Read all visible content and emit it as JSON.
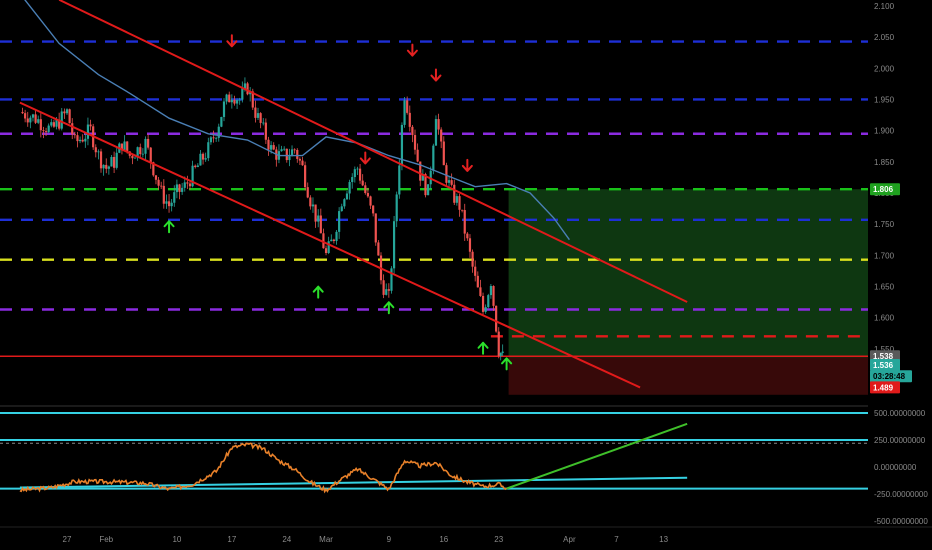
{
  "chart_data": {
    "type": "candlestick",
    "colors": {
      "background": "#000000",
      "up_candle": "#26a69a",
      "down_candle": "#ef5350",
      "channel": "#e11a1a",
      "moving_average": "#4a7fb5",
      "rsi_line": "#e8812a",
      "cyan_line": "#35d1e3",
      "green_trendline": "#3fbf2a",
      "target_zone": "#0f3a12",
      "stop_zone": "#3a0a0a"
    },
    "price_axis": {
      "ticks": [
        "2.100",
        "2.050",
        "2.000",
        "1.950",
        "1.900",
        "1.850",
        "1.800",
        "1.750",
        "1.700",
        "1.650",
        "1.600",
        "1.550",
        "1.500"
      ],
      "range": [
        1.48,
        2.11
      ]
    },
    "x_axis": {
      "ticks": [
        {
          "label": "27",
          "day": 0
        },
        {
          "label": "Feb",
          "day": 5
        },
        {
          "label": "10",
          "day": 14
        },
        {
          "label": "17",
          "day": 21
        },
        {
          "label": "24",
          "day": 28
        },
        {
          "label": "Mar",
          "day": 33
        },
        {
          "label": "9",
          "day": 41
        },
        {
          "label": "16",
          "day": 48
        },
        {
          "label": "23",
          "day": 55
        },
        {
          "label": "Apr",
          "day": 64
        },
        {
          "label": "7",
          "day": 70
        },
        {
          "label": "13",
          "day": 76
        }
      ]
    },
    "price_series": [
      {
        "day": -6,
        "p": 1.93
      },
      {
        "day": -4,
        "p": 1.92
      },
      {
        "day": -2,
        "p": 1.9
      },
      {
        "day": 0,
        "p": 1.93
      },
      {
        "day": 1,
        "p": 1.88
      },
      {
        "day": 2,
        "p": 1.89
      },
      {
        "day": 3,
        "p": 1.9
      },
      {
        "day": 4,
        "p": 1.86
      },
      {
        "day": 5,
        "p": 1.84
      },
      {
        "day": 6,
        "p": 1.85
      },
      {
        "day": 7,
        "p": 1.88
      },
      {
        "day": 8,
        "p": 1.86
      },
      {
        "day": 9,
        "p": 1.87
      },
      {
        "day": 10,
        "p": 1.88
      },
      {
        "day": 11,
        "p": 1.84
      },
      {
        "day": 12,
        "p": 1.8
      },
      {
        "day": 13,
        "p": 1.78
      },
      {
        "day": 14,
        "p": 1.8
      },
      {
        "day": 15,
        "p": 1.81
      },
      {
        "day": 16,
        "p": 1.83
      },
      {
        "day": 17,
        "p": 1.85
      },
      {
        "day": 18,
        "p": 1.87
      },
      {
        "day": 19,
        "p": 1.9
      },
      {
        "day": 20,
        "p": 1.94
      },
      {
        "day": 21,
        "p": 1.96
      },
      {
        "day": 22,
        "p": 1.95
      },
      {
        "day": 23,
        "p": 1.97
      },
      {
        "day": 24,
        "p": 1.93
      },
      {
        "day": 25,
        "p": 1.9
      },
      {
        "day": 26,
        "p": 1.87
      },
      {
        "day": 27,
        "p": 1.86
      },
      {
        "day": 28,
        "p": 1.86
      },
      {
        "day": 29,
        "p": 1.87
      },
      {
        "day": 30,
        "p": 1.84
      },
      {
        "day": 31,
        "p": 1.79
      },
      {
        "day": 32,
        "p": 1.75
      },
      {
        "day": 33,
        "p": 1.7
      },
      {
        "day": 34,
        "p": 1.73
      },
      {
        "day": 35,
        "p": 1.79
      },
      {
        "day": 36,
        "p": 1.82
      },
      {
        "day": 37,
        "p": 1.84
      },
      {
        "day": 38,
        "p": 1.8
      },
      {
        "day": 39,
        "p": 1.76
      },
      {
        "day": 40,
        "p": 1.66
      },
      {
        "day": 41,
        "p": 1.63
      },
      {
        "day": 42,
        "p": 1.8
      },
      {
        "day": 43,
        "p": 1.96
      },
      {
        "day": 44,
        "p": 1.9
      },
      {
        "day": 45,
        "p": 1.83
      },
      {
        "day": 46,
        "p": 1.8
      },
      {
        "day": 47,
        "p": 1.93
      },
      {
        "day": 48,
        "p": 1.84
      },
      {
        "day": 49,
        "p": 1.8
      },
      {
        "day": 50,
        "p": 1.78
      },
      {
        "day": 51,
        "p": 1.72
      },
      {
        "day": 52,
        "p": 1.66
      },
      {
        "day": 53,
        "p": 1.61
      },
      {
        "day": 54,
        "p": 1.66
      },
      {
        "day": 55,
        "p": 1.55
      },
      {
        "day": 55.5,
        "p": 1.536
      }
    ],
    "moving_average": [
      {
        "day": -6,
        "p": 2.12
      },
      {
        "day": -1,
        "p": 2.04
      },
      {
        "day": 4,
        "p": 1.99
      },
      {
        "day": 8,
        "p": 1.96
      },
      {
        "day": 13,
        "p": 1.92
      },
      {
        "day": 18,
        "p": 1.895
      },
      {
        "day": 23,
        "p": 1.885
      },
      {
        "day": 27,
        "p": 1.86
      },
      {
        "day": 30,
        "p": 1.86
      },
      {
        "day": 33,
        "p": 1.89
      },
      {
        "day": 37,
        "p": 1.88
      },
      {
        "day": 41,
        "p": 1.86
      },
      {
        "day": 45,
        "p": 1.845
      },
      {
        "day": 49,
        "p": 1.825
      },
      {
        "day": 52,
        "p": 1.81
      },
      {
        "day": 56,
        "p": 1.815
      },
      {
        "day": 59,
        "p": 1.8
      },
      {
        "day": 62,
        "p": 1.76
      },
      {
        "day": 64,
        "p": 1.725
      }
    ],
    "channel_upper": {
      "from": {
        "day": -1,
        "p": 2.11
      },
      "to": {
        "day": 79,
        "p": 1.625
      }
    },
    "channel_lower": {
      "from": {
        "day": -6,
        "p": 1.945
      },
      "to": {
        "day": 73,
        "p": 1.488
      }
    },
    "horizontal_levels": [
      {
        "price": 2.043,
        "color": "#1e2fd6"
      },
      {
        "price": 1.95,
        "color": "#1e2fd6"
      },
      {
        "price": 1.895,
        "color": "#8b2be0"
      },
      {
        "price": 1.806,
        "color": "#19c219"
      },
      {
        "price": 1.757,
        "color": "#1e2fd6"
      },
      {
        "price": 1.693,
        "color": "#d9e01e"
      },
      {
        "price": 1.613,
        "color": "#8b2be0"
      },
      {
        "price": 1.57,
        "color": "#e11a1a",
        "from_day": 54
      },
      {
        "price": 1.538,
        "color": "#e11a1a",
        "solid": true
      }
    ],
    "signals": {
      "sell_arrows": [
        {
          "day": 21,
          "p": 2.045
        },
        {
          "day": 38,
          "p": 1.857
        },
        {
          "day": 44,
          "p": 2.03
        },
        {
          "day": 47,
          "p": 1.99
        },
        {
          "day": 51,
          "p": 1.845
        }
      ],
      "buy_arrows": [
        {
          "day": 13,
          "p": 1.745
        },
        {
          "day": 32,
          "p": 1.64
        },
        {
          "day": 41,
          "p": 1.615
        },
        {
          "day": 53,
          "p": 1.55
        },
        {
          "day": 56,
          "p": 1.525
        }
      ]
    },
    "position": {
      "entry_day": 56,
      "end_day": 79,
      "entry_price": 1.536,
      "target_price": 1.806,
      "stop_price": 1.489
    },
    "price_tags": [
      {
        "label": "1.806",
        "price": 1.806,
        "bg": "#1fa11f",
        "fg": "#ffffff"
      },
      {
        "label": "1.538",
        "price": 1.538,
        "bg": "#5a5a5a",
        "fg": "#ffffff"
      },
      {
        "label": "1.536",
        "price": 1.524,
        "bg": "#26a69a",
        "fg": "#ffffff"
      },
      {
        "label": "03:28:48",
        "price": 1.506,
        "bg": "#26a69a",
        "fg": "#000000"
      },
      {
        "label": "1.489",
        "price": 1.488,
        "bg": "#e11a1a",
        "fg": "#ffffff"
      }
    ],
    "oscillator": {
      "axis_ticks": [
        "500.00000000",
        "250.00000000",
        "0.00000000",
        "-250.00000000",
        "-500.00000000"
      ],
      "range": [
        -560,
        600
      ],
      "levels": [
        {
          "value": 500,
          "color": "#35d1e3"
        },
        {
          "value": 250,
          "color": "#35d1e3"
        },
        {
          "value": -200,
          "color": "#35d1e3"
        },
        {
          "value": 220,
          "color": "#888888",
          "dashed": true
        }
      ],
      "series": [
        {
          "day": -6,
          "v": -215
        },
        {
          "day": -2,
          "v": -190
        },
        {
          "day": 1,
          "v": -135
        },
        {
          "day": 4,
          "v": -135
        },
        {
          "day": 7,
          "v": -140
        },
        {
          "day": 10,
          "v": -150
        },
        {
          "day": 13,
          "v": -205
        },
        {
          "day": 16,
          "v": -160
        },
        {
          "day": 19,
          "v": -40
        },
        {
          "day": 21,
          "v": 180
        },
        {
          "day": 23,
          "v": 210
        },
        {
          "day": 25,
          "v": 170
        },
        {
          "day": 27,
          "v": 60
        },
        {
          "day": 29,
          "v": -20
        },
        {
          "day": 31,
          "v": -140
        },
        {
          "day": 33,
          "v": -215
        },
        {
          "day": 35,
          "v": -110
        },
        {
          "day": 37,
          "v": -20
        },
        {
          "day": 39,
          "v": -110
        },
        {
          "day": 41,
          "v": -205
        },
        {
          "day": 43,
          "v": 60
        },
        {
          "day": 45,
          "v": 10
        },
        {
          "day": 47,
          "v": 40
        },
        {
          "day": 49,
          "v": -80
        },
        {
          "day": 51,
          "v": -140
        },
        {
          "day": 53,
          "v": -180
        },
        {
          "day": 55,
          "v": -160
        },
        {
          "day": 56,
          "v": -195
        }
      ],
      "cyan_trend": {
        "from": {
          "day": -6,
          "v": -190
        },
        "to": {
          "day": 79,
          "v": -100
        }
      },
      "green_trend": {
        "from": {
          "day": 56,
          "v": -200
        },
        "to": {
          "day": 79,
          "v": 400
        }
      }
    }
  }
}
